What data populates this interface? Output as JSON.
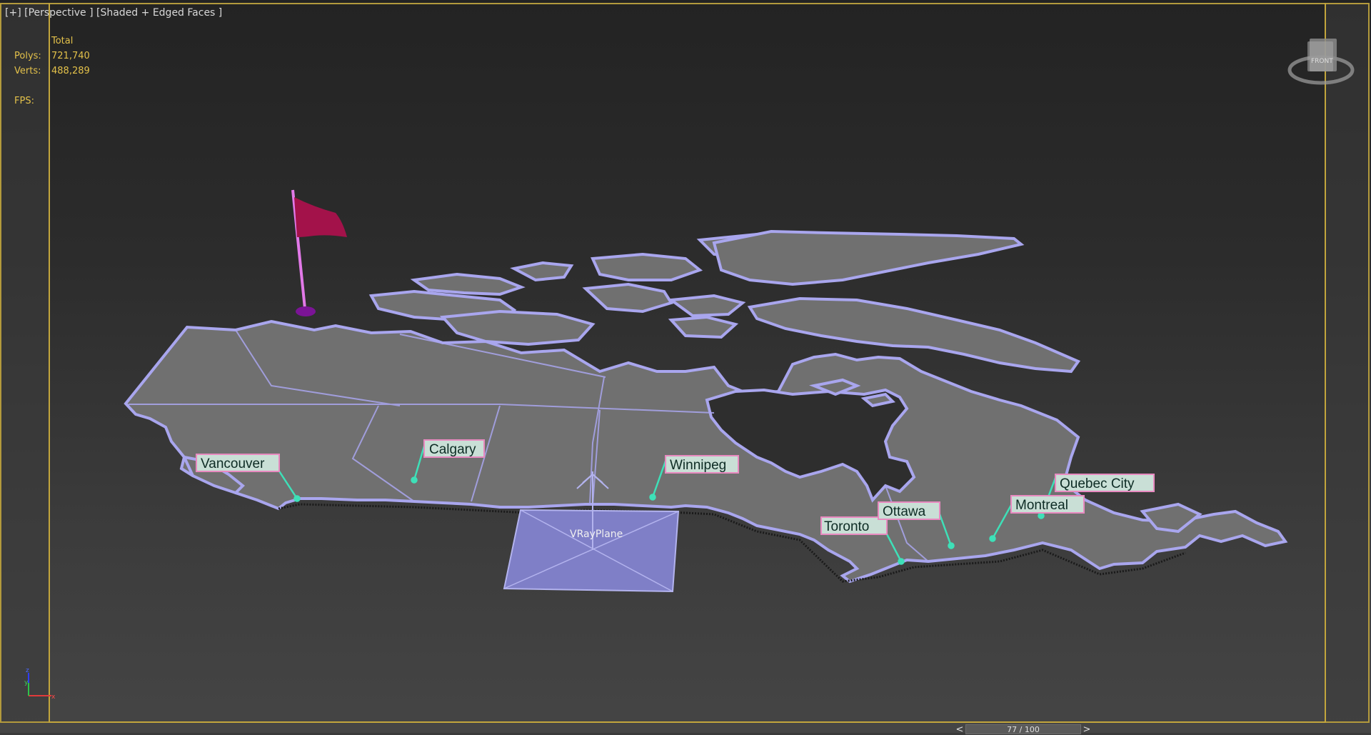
{
  "viewport": {
    "label": "[+] [Perspective ] [Shaded + Edged Faces ]"
  },
  "stats": {
    "header": "Total",
    "polys_label": "Polys:",
    "polys_value": "721,740",
    "verts_label": "Verts:",
    "verts_value": "488,289",
    "fps_label": "FPS:",
    "fps_value": ""
  },
  "scene": {
    "cities": [
      {
        "name": "Vancouver"
      },
      {
        "name": "Calgary"
      },
      {
        "name": "Winnipeg"
      },
      {
        "name": "Toronto"
      },
      {
        "name": "Ottawa"
      },
      {
        "name": "Montreal"
      },
      {
        "name": "Quebec City"
      }
    ],
    "plane_label": "VRayPlane"
  },
  "viewcube": {
    "face_label": "FRONT"
  },
  "timeline": {
    "prev": "<",
    "frame_text": "77 / 100",
    "next": ">"
  },
  "axis": {
    "z": "z",
    "y": "y",
    "x": "x"
  },
  "colors": {
    "frame": "#c2a53c",
    "stat_text": "#e3c14a",
    "map_fill": "#6e6e6e",
    "map_edge": "#a9a6ee",
    "city_label_bg": "#c9dfd6",
    "city_label_border": "#e88ac0",
    "city_line": "#3ee0b8",
    "flag": "#a3124a",
    "flag_pole": "#e279e8",
    "plane": "#7f7fc7"
  }
}
